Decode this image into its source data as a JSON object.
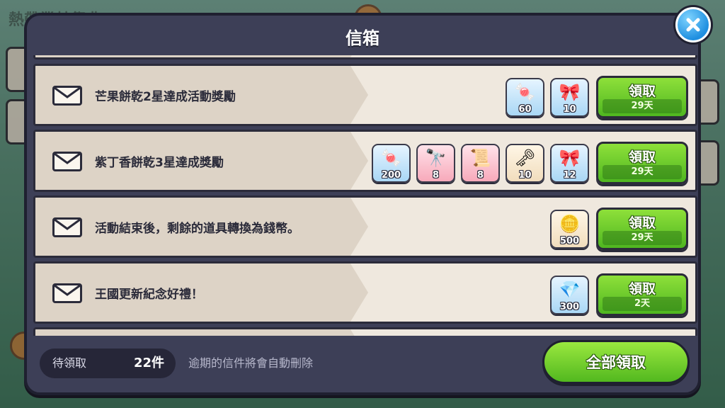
{
  "modal": {
    "title": "信箱"
  },
  "background": {
    "title": "熱帶叢林祭典"
  },
  "mails": [
    {
      "title": "芒果餅乾2星達成活動獎勵",
      "rewards": [
        {
          "icon": "jelly-pile-icon",
          "qty": "60",
          "tint": "blue"
        },
        {
          "icon": "ribbon-shard-icon",
          "qty": "10",
          "tint": "blue"
        }
      ],
      "button": "領取",
      "days": "29天"
    },
    {
      "title": "紫丁香餅乾3星達成獎勵",
      "rewards": [
        {
          "icon": "jelly-pile-icon",
          "qty": "200",
          "tint": "blue"
        },
        {
          "icon": "telescope-icon",
          "qty": "8",
          "tint": "pink"
        },
        {
          "icon": "map-scroll-icon",
          "qty": "8",
          "tint": "pink"
        },
        {
          "icon": "red-key-icon",
          "qty": "10",
          "tint": "cream"
        },
        {
          "icon": "ribbon-shard-icon",
          "qty": "12",
          "tint": "blue"
        }
      ],
      "button": "領取",
      "days": "29天"
    },
    {
      "title": "活動結束後，剩餘的道具轉換為錢幣。",
      "rewards": [
        {
          "icon": "gold-coin-icon",
          "qty": "500",
          "tint": "cream"
        }
      ],
      "button": "領取",
      "days": "29天"
    },
    {
      "title": "王國更新紀念好禮！",
      "rewards": [
        {
          "icon": "blue-crystal-icon",
          "qty": "300",
          "tint": "blue"
        }
      ],
      "button": "領取",
      "days": "2天"
    }
  ],
  "footer": {
    "pending_label": "待領取",
    "pending_count": "22件",
    "expire_note": "逾期的信件將會自動刪除",
    "claim_all": "全部領取"
  },
  "glyphs": {
    "jelly-pile-icon": "🍬",
    "ribbon-shard-icon": "🎀",
    "telescope-icon": "🔭",
    "map-scroll-icon": "📜",
    "red-key-icon": "🗝",
    "gold-coin-icon": "🪙",
    "blue-crystal-icon": "💎"
  }
}
